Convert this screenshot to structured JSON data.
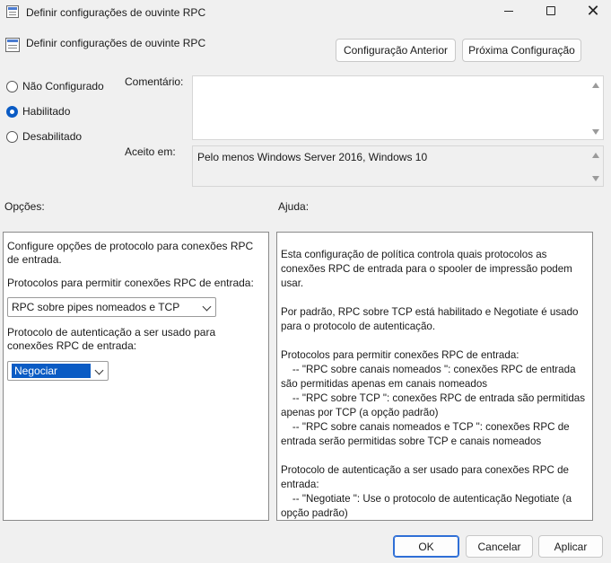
{
  "window": {
    "title": "Definir configurações de ouvinte RPC",
    "minimize_icon": "minimize-icon",
    "maximize_icon": "maximize-icon",
    "close_icon": "close-icon",
    "close_glyph": "✕"
  },
  "header": {
    "setting_title": "Definir configurações de ouvinte RPC",
    "prev_label": "Configuração Anterior",
    "next_label": "Próxima Configuração"
  },
  "state": {
    "options": [
      {
        "label": "Não Configurado",
        "checked": false
      },
      {
        "label": "Habilitado",
        "checked": true
      },
      {
        "label": "Desabilitado",
        "checked": false
      }
    ]
  },
  "comment": {
    "label": "Comentário:",
    "value": ""
  },
  "supported": {
    "label": "Aceito em:",
    "value": "Pelo menos Windows Server 2016, Windows 10"
  },
  "options_panel": {
    "label": "Opções:",
    "intro": "Configure opções de protocolo para conexões RPC de entrada.",
    "protocols_label": "Protocolos para permitir conexões RPC de entrada:",
    "protocols_value": "RPC sobre pipes nomeados e TCP",
    "auth_label": "Protocolo de autenticação a ser usado para conexões RPC de entrada:",
    "auth_value": "Negociar"
  },
  "help_panel": {
    "label": "Ajuda:",
    "text": "Esta configuração de política controla quais protocolos as conexões RPC de entrada para o spooler de impressão podem usar.\n\nPor padrão, RPC sobre TCP está habilitado e Negotiate é usado para o protocolo de autenticação.\n\nProtocolos para permitir conexões RPC de entrada:\n    -- \"RPC sobre canais nomeados \": conexões RPC de entrada são permitidas apenas em canais nomeados\n    -- \"RPC sobre TCP \": conexões RPC de entrada são permitidas apenas por TCP (a opção padrão)\n    -- \"RPC sobre canais nomeados e TCP \": conexões RPC de entrada serão permitidas sobre TCP e canais nomeados\n\nProtocolo de autenticação a ser usado para conexões RPC de entrada:\n    -- \"Negotiate \": Use o protocolo de autenticação Negotiate (a opção padrão)\n    -- \"Kerberos\": use o protocolo de autenticação Kerberos"
  },
  "footer": {
    "ok_label": "OK",
    "cancel_label": "Cancelar",
    "apply_label": "Aplicar"
  },
  "colors": {
    "accent": "#0a5bc4",
    "background": "#f0f0f0"
  }
}
